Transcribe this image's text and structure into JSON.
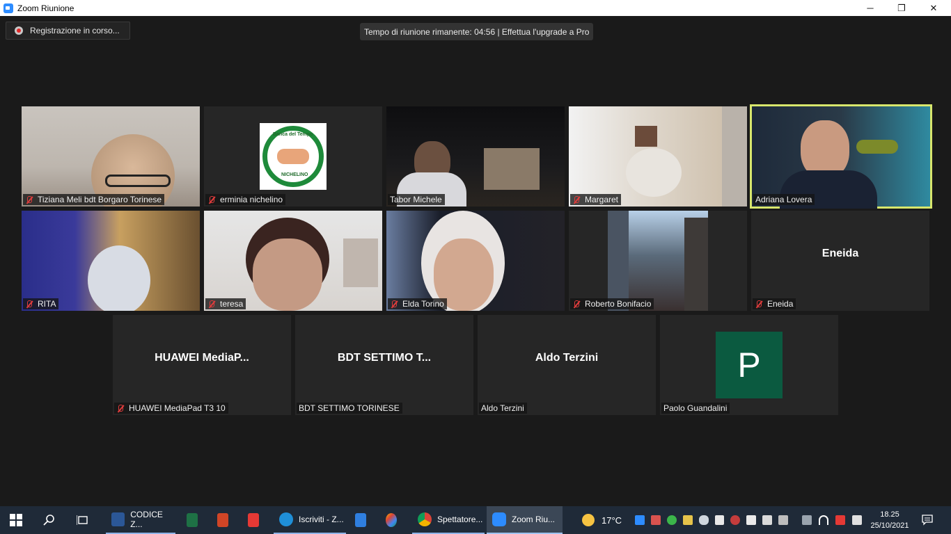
{
  "window": {
    "title": "Zoom Riunione",
    "minimize_glyph": "─",
    "restore_glyph": "❐",
    "close_glyph": "✕"
  },
  "recording": {
    "label": "Registrazione in corso..."
  },
  "meeting_timer": {
    "text": "Tempo di riunione rimanente: 04:56 | Effettua l'upgrade a Pro"
  },
  "participants_row1": [
    {
      "name": "Tiziana Meli bdt Borgaro Torinese",
      "muted": true
    },
    {
      "name": "erminia nichelino",
      "muted": true
    },
    {
      "name": "Tabor Michele",
      "muted": false
    },
    {
      "name": "Margaret",
      "muted": true
    },
    {
      "name": "Adriana Lovera",
      "muted": false,
      "active_speaker": true
    }
  ],
  "participants_row2": [
    {
      "name": "RITA",
      "muted": true
    },
    {
      "name": "teresa",
      "muted": true
    },
    {
      "name": "Elda Torino",
      "muted": true
    },
    {
      "name": "Roberto Bonifacio",
      "muted": true
    },
    {
      "name": "Eneida",
      "muted": true,
      "display": "Eneida"
    }
  ],
  "participants_row3": [
    {
      "name": "HUAWEI MediaPad T3 10",
      "muted": true,
      "display": "HUAWEI  MediaP..."
    },
    {
      "name": "BDT SETTIMO TORINESE",
      "muted": false,
      "display": "BDT  SETTIMO  T..."
    },
    {
      "name": "Aldo Terzini",
      "muted": false,
      "display": "Aldo Terzini"
    },
    {
      "name": "Paolo Guandalini",
      "muted": false,
      "avatar_letter": "P"
    }
  ],
  "logo": {
    "top_text": "Banca del Tempo",
    "bottom_text": "NICHELINO"
  },
  "taskbar": {
    "apps": [
      {
        "label": "CODICE Z...",
        "icon": "word-icon"
      },
      {
        "label": "Iscriviti - Z...",
        "icon": "edge-icon"
      },
      {
        "label": "Spettatore...",
        "icon": "chrome-icon"
      },
      {
        "label": "Zoom Riu...",
        "icon": "zoom-icon"
      }
    ],
    "weather": {
      "temp": "17°C",
      "icon": "sun-icon"
    },
    "clock": {
      "time": "18.25",
      "date": "25/10/2021"
    }
  },
  "colors": {
    "active_speaker_border": "#d8e76c",
    "muted_mic": "#e03c3c",
    "avatar_bg": "#0b5a40",
    "taskbar_bg": "#1f2a38"
  }
}
